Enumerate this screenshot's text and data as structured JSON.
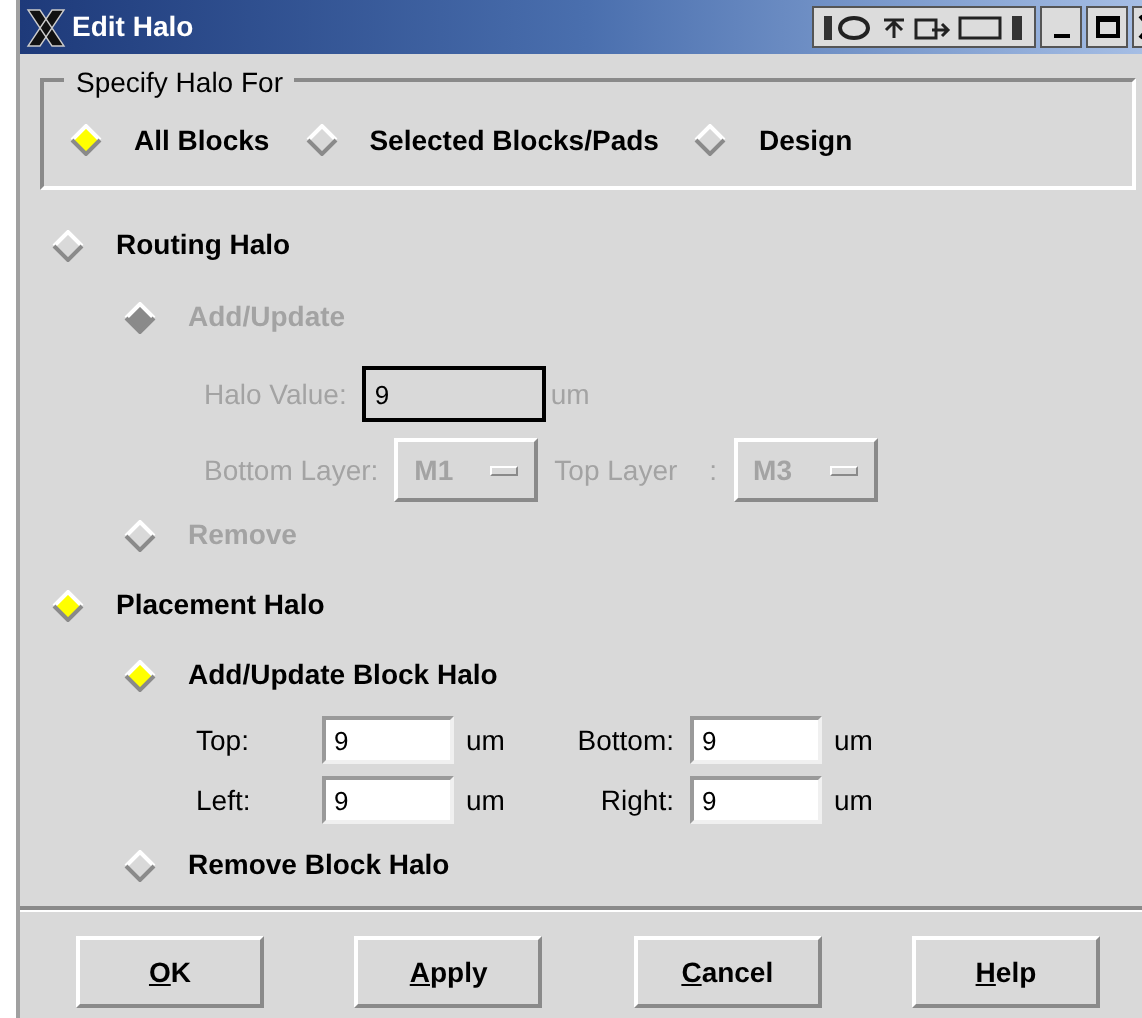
{
  "window": {
    "title": "Edit Halo"
  },
  "specify": {
    "legend": "Specify Halo For",
    "options": [
      {
        "label": "All Blocks",
        "selected": true
      },
      {
        "label": "Selected Blocks/Pads",
        "selected": false
      },
      {
        "label": "Design",
        "selected": false
      }
    ]
  },
  "routing": {
    "label": "Routing Halo",
    "selected": false,
    "add": {
      "label": "Add/Update",
      "selected": true,
      "disabled": true
    },
    "halo_value": {
      "label": "Halo Value:",
      "value": "9",
      "unit": "um",
      "disabled": true
    },
    "bottom_layer": {
      "label": "Bottom Layer:",
      "value": "M1",
      "disabled": true
    },
    "top_layer": {
      "label": "Top Layer",
      "colon": ":",
      "value": "M3",
      "disabled": true
    },
    "remove": {
      "label": "Remove",
      "selected": false,
      "disabled": true
    }
  },
  "placement": {
    "label": "Placement Halo",
    "selected": true,
    "add": {
      "label": "Add/Update Block Halo",
      "selected": true,
      "disabled": false
    },
    "fields": [
      {
        "label": "Top:",
        "value": "9",
        "unit": "um"
      },
      {
        "label": "Bottom:",
        "value": "9",
        "unit": "um"
      },
      {
        "label": "Left:",
        "value": "9",
        "unit": "um"
      },
      {
        "label": "Right:",
        "value": "9",
        "unit": "um"
      }
    ],
    "remove": {
      "label": "Remove Block Halo",
      "selected": false,
      "disabled": false
    }
  },
  "buttons": [
    {
      "mnemonic": "O",
      "rest": "K"
    },
    {
      "mnemonic": "A",
      "rest": "pply"
    },
    {
      "mnemonic": "C",
      "rest": "ancel"
    },
    {
      "mnemonic": "H",
      "rest": "elp"
    }
  ]
}
